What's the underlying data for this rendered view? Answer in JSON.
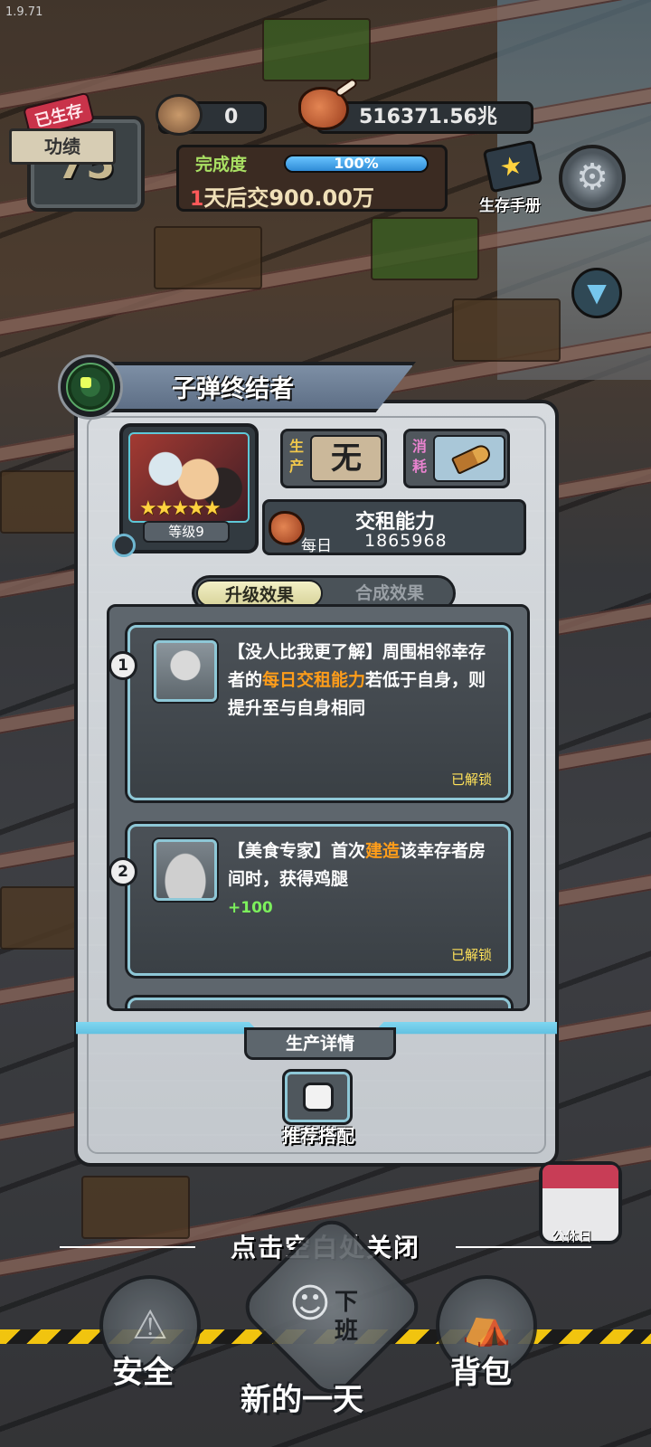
{
  "version": "1.9.71",
  "hud": {
    "days_badge": "已生存",
    "days": "75",
    "merit_label": "功绩",
    "canned_food": "0",
    "meat": "516371.56兆",
    "progress": {
      "label": "完成度",
      "value_text": "100%",
      "fraction": 1.0
    },
    "deadline": {
      "days": "1",
      "text": "天后交",
      "amount": "900.00万"
    },
    "manual_label": "生存手册",
    "icons": {
      "settings": "gear-icon",
      "collapse": "chevron-down-icon"
    }
  },
  "dialog": {
    "title": "子弹终结者",
    "level": "等级9",
    "stars": "★★★★★",
    "star_count": 5,
    "production_label": "生产",
    "production_value": "无",
    "consumption_label": "消耗",
    "consumption_item": "bullet-icon",
    "rent": {
      "title": "交租能力",
      "period": "每日",
      "value": "1865968"
    },
    "tabs": [
      "升级效果",
      "合成效果"
    ],
    "active_tab": "升级效果",
    "effects": [
      {
        "index": "1",
        "text_before": "【没人比我更了解】周围相邻幸存者的",
        "highlight": "每日交租能力",
        "text_after": "若低于自身，则提升至与自身相同",
        "bonus": "",
        "status": "已解锁"
      },
      {
        "index": "2",
        "text_before": "【美食专家】首次",
        "highlight": "建造",
        "text_after": "该幸存者房间时，获得鸡腿",
        "bonus": "+100",
        "status": "已解锁"
      }
    ],
    "detail_tab": "生产详情",
    "recommend_label": "推荐搭配"
  },
  "close_hint": "点击空白处关闭",
  "calendar_label": "公休日",
  "bottom_nav": {
    "safety": "安全",
    "new_day": "新的一天",
    "off_work": "下班",
    "backpack": "背包"
  },
  "colors": {
    "highlight": "#ff9d1a",
    "bonus": "#7cf05c",
    "unlocked": "#ffe25a",
    "accent": "#8ec7d6"
  }
}
